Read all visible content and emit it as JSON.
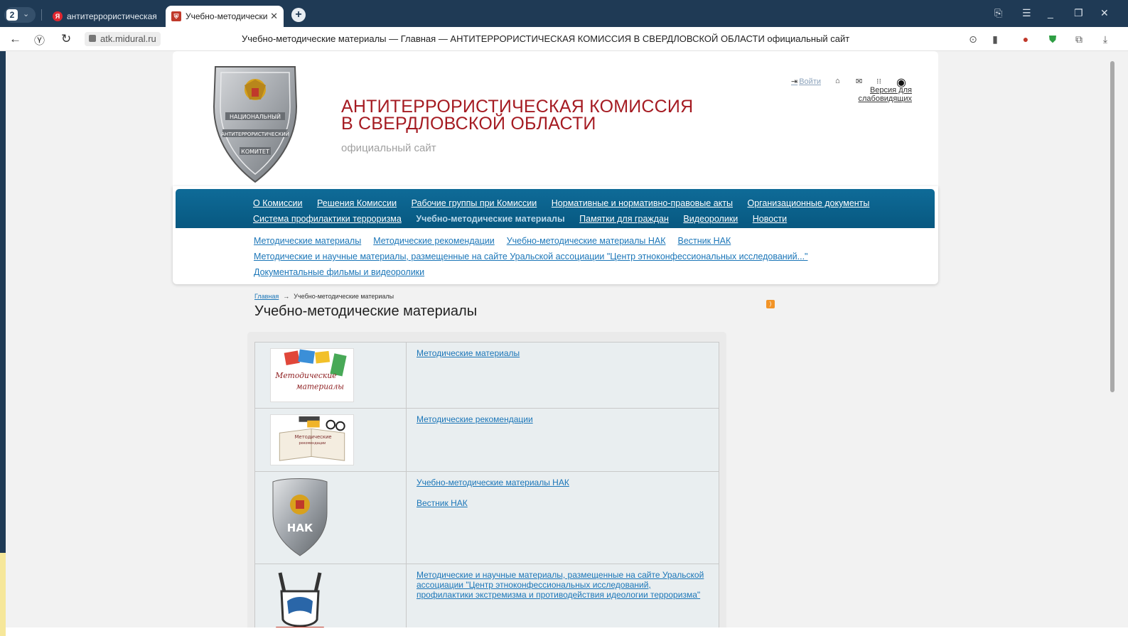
{
  "browser": {
    "tab_count": "2",
    "tabs": [
      {
        "title": "антитеррористическая ко",
        "favicon": "Я"
      },
      {
        "title": "Учебно-методические",
        "favicon": "🛡"
      }
    ],
    "url": "atk.midural.ru",
    "page_title": "Учебно-методические материалы — Главная — АНТИТЕРРОРИСТИЧЕСКАЯ КОМИССИЯ В СВЕРДЛОВСКОЙ ОБЛАСТИ официальный сайт"
  },
  "header": {
    "site_name_line1": "АНТИТЕРРОРИСТИЧЕСКАЯ КОМИССИЯ",
    "site_name_line2": "В СВЕРДЛОВСКОЙ ОБЛАСТИ",
    "site_sub": "официальный сайт",
    "emblem_text": [
      "НАЦИОНАЛЬНЫЙ",
      "АНТИТЕРРОРИСТИЧЕСКИЙ",
      "КОМИТЕТ"
    ],
    "login": "Войти",
    "impaired_version": "Версия для слабовидящих"
  },
  "menu": {
    "row1": [
      "О Комиссии",
      "Решения Комиссии",
      "Рабочие группы при Комиссии",
      "Нормативные и нормативно-правовые акты",
      "Организационные документы"
    ],
    "row2": [
      "Система профилактики терроризма",
      "Учебно-методические материалы",
      "Памятки для граждан",
      "Видеоролики",
      "Новости"
    ],
    "active": "Учебно-методические материалы"
  },
  "submenu": [
    "Методические материалы",
    "Методические рекомендации",
    "Учебно-методические материалы НАК",
    "Вестник НАК",
    "Методические и научные материалы, размещенные на сайте Уральской ассоциации \"Центр этноконфессиональных исследований...\"",
    "Документальные фильмы и видеоролики"
  ],
  "breadcrumb": {
    "home": "Главная",
    "arrow": "→",
    "current": "Учебно-методические материалы"
  },
  "page_heading": "Учебно-методические материалы",
  "table": [
    {
      "thumb_caption": [
        "Методические",
        "материалы"
      ],
      "links": [
        "Методические материалы"
      ]
    },
    {
      "thumb_caption": [
        "Методические",
        "рекомендации"
      ],
      "links": [
        "Методические рекомендации"
      ]
    },
    {
      "thumb_caption": [
        "НАК"
      ],
      "links": [
        "Учебно-методические материалы НАК",
        "Вестник НАК"
      ]
    },
    {
      "thumb_caption": [],
      "links": [
        "Методические и научные материалы, размещенные на сайте Уральской ассоциации \"Центр этноконфессиональных исследований, профилактики экстремизма и противодействия идеологии терроризма\""
      ]
    }
  ],
  "colors": {
    "brand_red": "#a51b22",
    "menu_blue": "#0a628c",
    "link_blue": "#1b76b8",
    "chrome": "#1f3a55"
  }
}
